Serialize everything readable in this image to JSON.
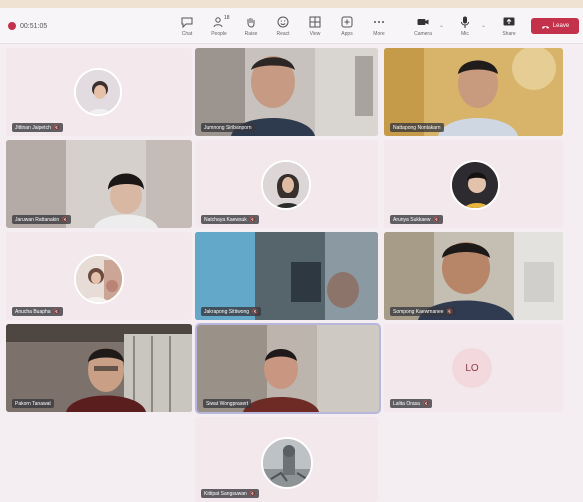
{
  "toolbar": {
    "recording_time": "00:51:05",
    "buttons": [
      {
        "id": "chat",
        "label": "Chat",
        "icon": "chat-icon"
      },
      {
        "id": "people",
        "label": "People",
        "badge": "18",
        "icon": "people-icon"
      },
      {
        "id": "raise",
        "label": "Raise",
        "icon": "raise-hand-icon"
      },
      {
        "id": "react",
        "label": "React",
        "icon": "react-icon"
      },
      {
        "id": "view",
        "label": "View",
        "icon": "view-icon"
      },
      {
        "id": "apps",
        "label": "Apps",
        "icon": "apps-icon"
      },
      {
        "id": "more",
        "label": "More",
        "icon": "more-icon"
      },
      {
        "id": "camera",
        "label": "Camera",
        "icon": "camera-icon"
      },
      {
        "id": "mic",
        "label": "Mic",
        "icon": "mic-icon"
      },
      {
        "id": "share",
        "label": "Share",
        "icon": "share-icon"
      }
    ],
    "leave_label": "Leave",
    "leave_color": "#c4314b"
  },
  "participants": [
    {
      "name": "Jittinan Jaipetch",
      "muted": true,
      "video": false
    },
    {
      "name": "Jumnong Siribanporn",
      "muted": false,
      "video": true
    },
    {
      "name": "Nattapong Nontakarn",
      "muted": false,
      "video": true
    },
    {
      "name": "Jaruwan Rattanakin",
      "muted": true,
      "video": false
    },
    {
      "name": "Natchaya Kaewsuk",
      "muted": true,
      "video": false
    },
    {
      "name": "Arunya Sukkaew",
      "muted": true,
      "video": false
    },
    {
      "name": "Anucha Buapha",
      "muted": true,
      "video": false
    },
    {
      "name": "Jakrapong Sittiwong",
      "muted": true,
      "video": true
    },
    {
      "name": "Sompong Kaewmanee",
      "muted": true,
      "video": true
    },
    {
      "name": "Pakorn Tanawat",
      "muted": false,
      "video": true
    },
    {
      "name": "Siwat Wongprasert",
      "muted": false,
      "video": true
    },
    {
      "name": "Lalita Orasa",
      "initials": "LO",
      "muted": true,
      "video": false
    },
    {
      "name": "Kittipat Sangsuwan",
      "muted": true,
      "video": false
    }
  ]
}
